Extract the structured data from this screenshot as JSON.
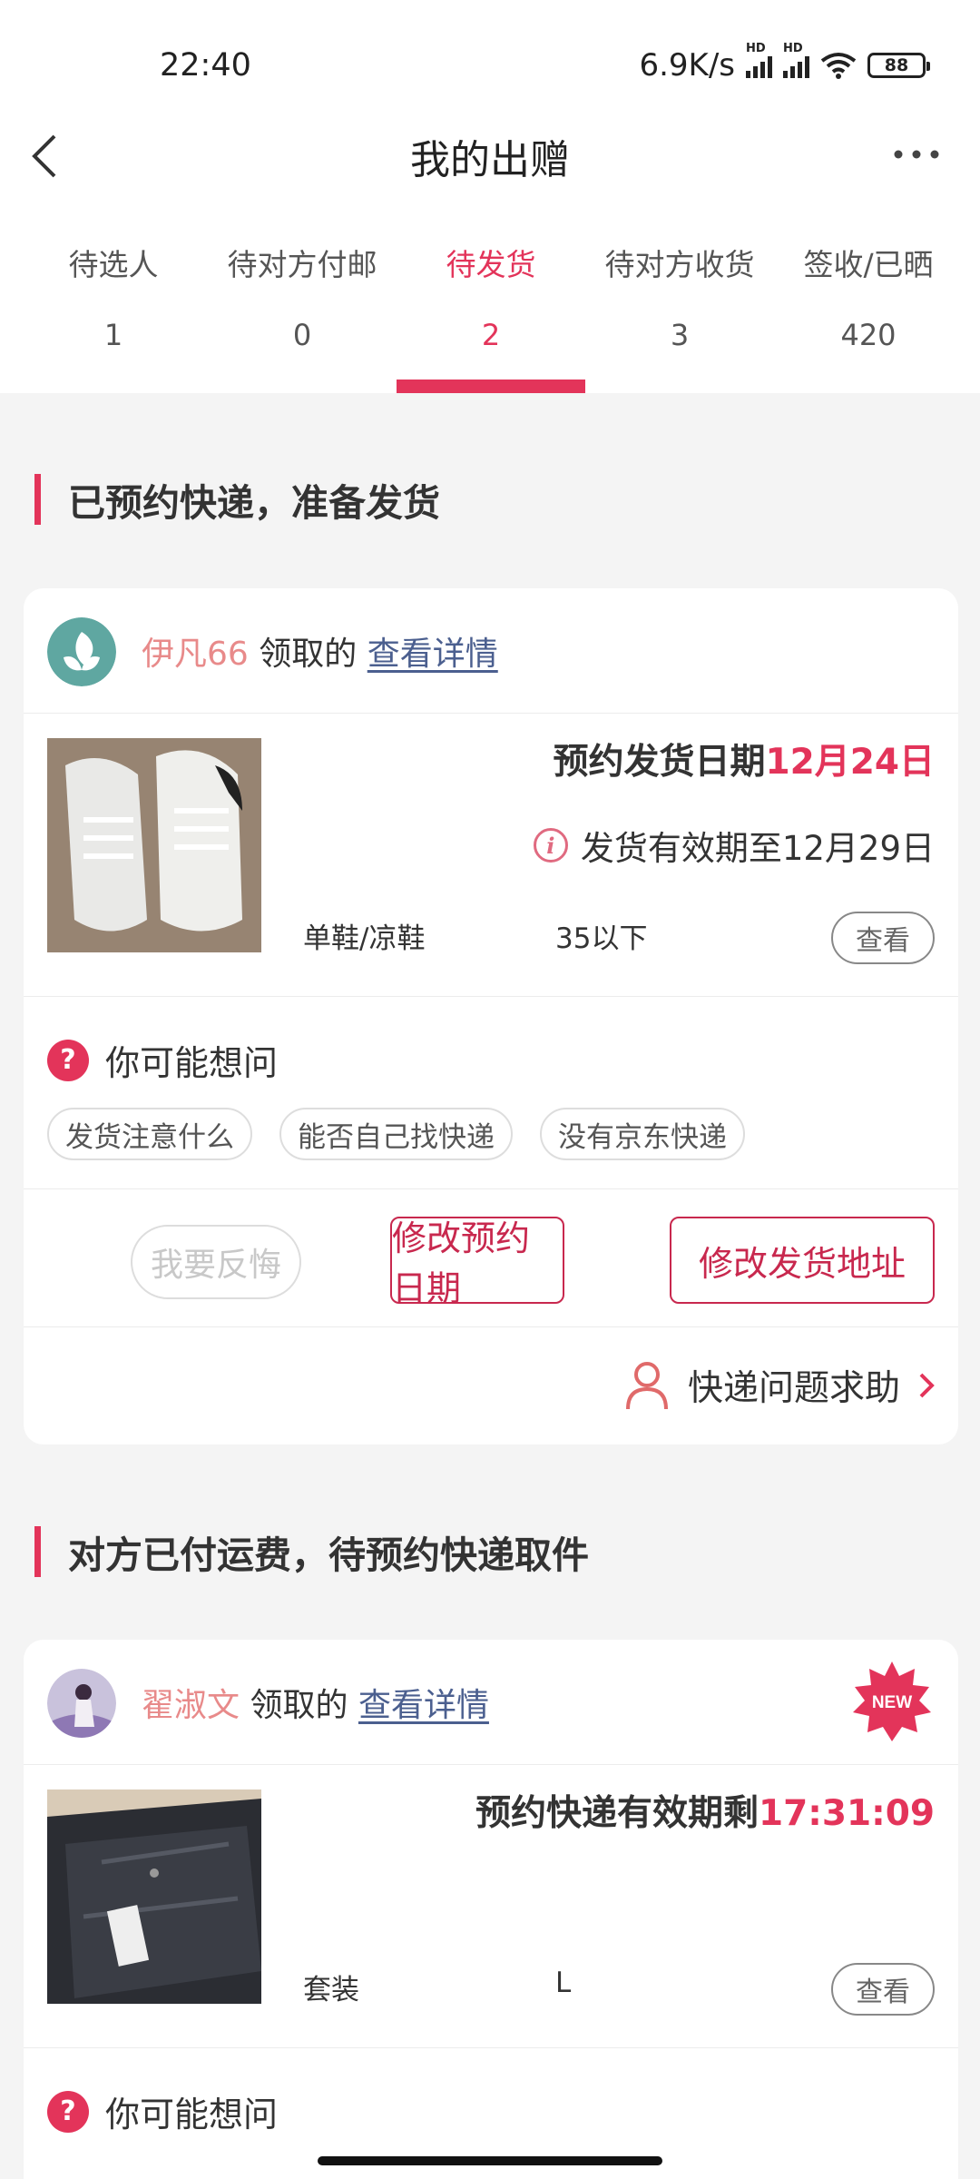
{
  "status_bar": {
    "time": "22:40",
    "net_speed": "6.9K/s",
    "battery": "88"
  },
  "nav": {
    "title": "我的出赠"
  },
  "tabs": [
    {
      "label": "待选人",
      "count": "1"
    },
    {
      "label": "待对方付邮",
      "count": "0"
    },
    {
      "label": "待发货",
      "count": "2",
      "active": true
    },
    {
      "label": "待对方收货",
      "count": "3"
    },
    {
      "label": "签收/已晒",
      "count": "420"
    }
  ],
  "sections": [
    {
      "title": "已预约快递，准备发货"
    },
    {
      "title": "对方已付运费，待预约快递取件"
    }
  ],
  "card1": {
    "giver_name": "伊凡66",
    "received_label": "领取的",
    "detail_link": "查看详情",
    "date_prefix": "预约发货日期",
    "date_value": "12月24日",
    "validity": "发货有效期至12月29日",
    "category": "单鞋/凉鞋",
    "size": "35以下",
    "view_label": "查看",
    "faq_title": "你可能想问",
    "faq_chips": [
      "发货注意什么",
      "能否自己找快递",
      "没有京东快递"
    ],
    "regret_label": "我要反悔",
    "change_date_label": "修改预约日期",
    "change_address_label": "修改发货地址",
    "help_label": "快递问题求助"
  },
  "card2": {
    "giver_name": "翟淑文",
    "received_label": "领取的",
    "detail_link": "查看详情",
    "badge": "NEW",
    "countdown_prefix": "预约快递有效期剩",
    "countdown_value": "17:31:09",
    "category": "套装",
    "size": "L",
    "view_label": "查看",
    "faq_title": "你可能想问"
  },
  "colors": {
    "accent": "#e3345a",
    "link": "#4b5f8f",
    "name": "#e88a8a"
  }
}
